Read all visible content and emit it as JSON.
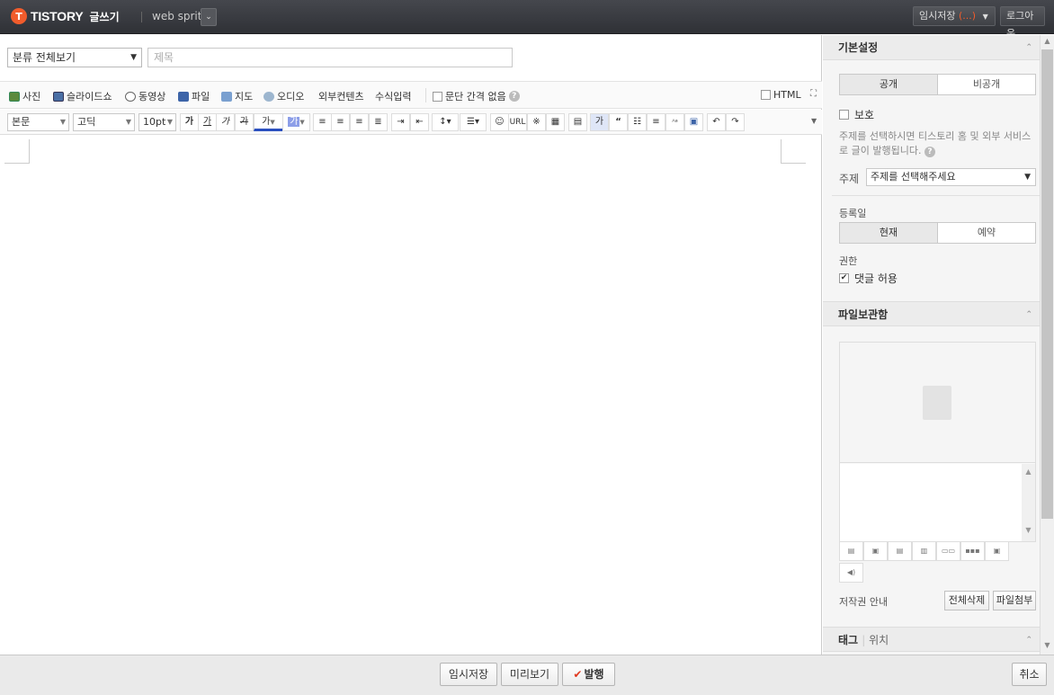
{
  "topbar": {
    "logo_text": "TISTORY",
    "logo_mark": "T",
    "page_label": "글쓰기",
    "blog_name": "web sprit",
    "temp_save_label": "임시저장",
    "temp_save_count": "(...)",
    "logout_label": "로그아웃"
  },
  "editor": {
    "category": "분류 전체보기",
    "title_placeholder": "제목",
    "media": {
      "photo": "사진",
      "slideshow": "슬라이드쇼",
      "video": "동영상",
      "file": "파일",
      "map": "지도",
      "audio": "오디오",
      "external": "외부컨텐츠",
      "formula": "수식입력",
      "no_paragraph_gap": "문단 간격 없음",
      "html": "HTML"
    },
    "format": {
      "style": "본문",
      "font": "고딕",
      "size": "10pt",
      "bold": "가",
      "underline": "가",
      "italic": "가",
      "strike": "가",
      "font_color": "가",
      "bg_color": "가",
      "url": "URL",
      "special": "※"
    }
  },
  "sidebar": {
    "basic_settings": "기본설정",
    "public": "공개",
    "private": "비공개",
    "protect": "보호",
    "topic_notice": "주제를 선택하시면 티스토리 홈 및 외부 서비스로 글이 발행됩니다.",
    "topic_label": "주제",
    "topic_select": "주제를 선택해주세요",
    "date_label": "등록일",
    "now": "현재",
    "reserve": "예약",
    "permission_label": "권한",
    "allow_comments": "댓글 허용",
    "file_box": "파일보관함",
    "copyright": "저작권 안내",
    "delete_all": "전체삭제",
    "attach_file": "파일첨부",
    "tag_tab": "태그",
    "location_tab": "위치"
  },
  "bottom": {
    "temp_save": "임시저장",
    "preview": "미리보기",
    "publish": "발행",
    "cancel": "취소"
  },
  "colors": {
    "brand": "#f15c2c",
    "topbar": "#3a3c41",
    "publish_check": "#e0381f"
  }
}
